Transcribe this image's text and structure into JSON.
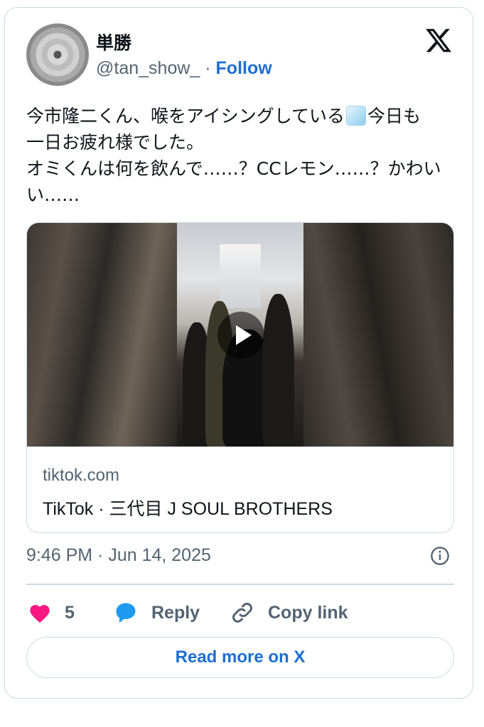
{
  "author": {
    "name": "単勝",
    "handle": "@tan_show_",
    "separator": " · ",
    "follow_label": "Follow"
  },
  "tweet": {
    "text_part1": "今市隆二くん、喉をアイシングしている",
    "emoji_icon": "ice-cube-emoji",
    "text_part2": "今日も\n一日お疲れ様でした。\nオミくんは何を飲んで……？CCレモン……？かわいい……"
  },
  "link_card": {
    "domain": "tiktok.com",
    "title": "TikTok · 三代目 J SOUL BROTHERS"
  },
  "timestamp": "9:46 PM · Jun 14, 2025",
  "actions": {
    "like_count": "5",
    "reply_label": "Reply",
    "copy_label": "Copy link"
  },
  "read_more_label": "Read more on X",
  "colors": {
    "accent": "#1d6fd1",
    "like": "#f91880",
    "reply_icon": "#1d9bf0",
    "border": "#cfd9de",
    "muted": "#536471"
  }
}
